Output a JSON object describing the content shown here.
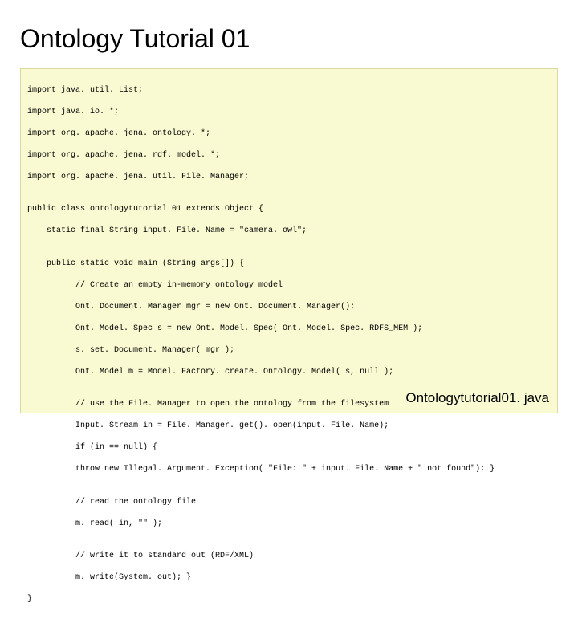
{
  "title": "Ontology Tutorial 01",
  "filename_label": "Ontologytutorial01. java",
  "code": {
    "l01": "import java. util. List;",
    "l02": "import java. io. *;",
    "l03": "import org. apache. jena. ontology. *;",
    "l04": "import org. apache. jena. rdf. model. *;",
    "l05": "import org. apache. jena. util. File. Manager;",
    "l06": "",
    "l07": "public class ontologytutorial 01 extends Object {",
    "l08": "    static final String input. File. Name = \"camera. owl\";",
    "l09": "",
    "l10": "    public static void main (String args[]) {",
    "l11": "          // Create an empty in-memory ontology model",
    "l12": "          Ont. Document. Manager mgr = new Ont. Document. Manager();",
    "l13": "          Ont. Model. Spec s = new Ont. Model. Spec( Ont. Model. Spec. RDFS_MEM );",
    "l14": "          s. set. Document. Manager( mgr );",
    "l15": "          Ont. Model m = Model. Factory. create. Ontology. Model( s, null );",
    "l16": "",
    "l17": "          // use the File. Manager to open the ontology from the filesystem",
    "l18": "          Input. Stream in = File. Manager. get(). open(input. File. Name);",
    "l19": "          if (in == null) {",
    "l20": "          throw new Illegal. Argument. Exception( \"File: \" + input. File. Name + \" not found\"); }",
    "l21": "",
    "l22": "          // read the ontology file",
    "l23": "          m. read( in, \"\" );",
    "l24": "",
    "l25": "          // write it to standard out (RDF/XML)",
    "l26": "          m. write(System. out); }",
    "l27": "}"
  }
}
